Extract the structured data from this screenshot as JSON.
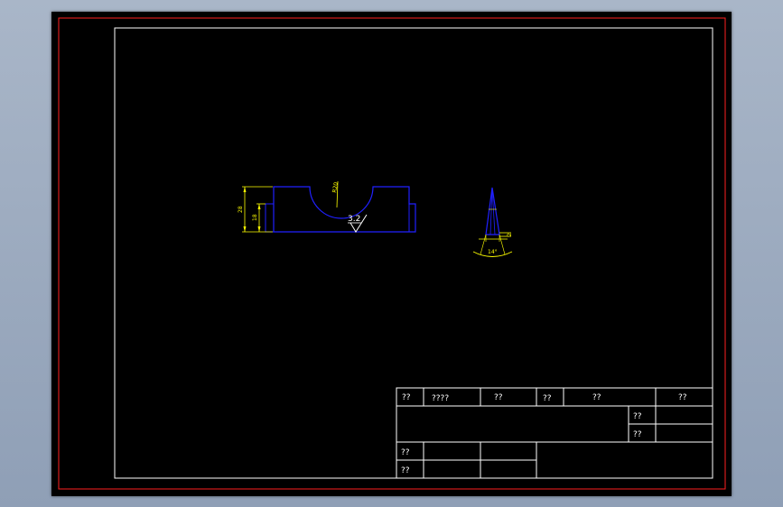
{
  "colors": {
    "frame_outer": "#ff2020",
    "frame_inner": "#ffffff",
    "part_outline": "#2020ff",
    "dimension": "#ffff00",
    "background": "#000000"
  },
  "drawing": {
    "dimensions": {
      "height_overall": "28",
      "height_step": "18",
      "radius": "R20",
      "angle": "14°",
      "small_dim": "2",
      "roughness": "3.2"
    }
  },
  "title_block": {
    "header": [
      "??",
      "????",
      "??",
      "??",
      "??",
      "??"
    ],
    "right_labels": [
      "??",
      "??"
    ],
    "left_labels": [
      "??",
      "??"
    ]
  }
}
